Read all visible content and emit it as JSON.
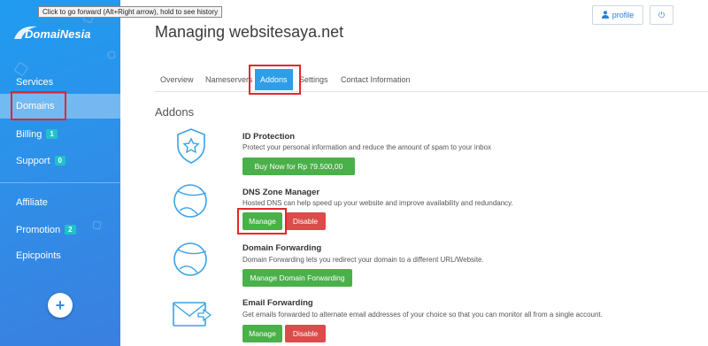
{
  "tooltip": "Click to go forward (Alt+Right arrow), hold to see history",
  "logo": {
    "text": "DomaiNesia"
  },
  "sidebar": {
    "items": [
      {
        "label": "Services",
        "badge": null
      },
      {
        "label": "Domains",
        "badge": null
      },
      {
        "label": "Billing",
        "badge": "1"
      },
      {
        "label": "Support",
        "badge": "0"
      },
      {
        "label": "Affiliate",
        "badge": null
      },
      {
        "label": "Promotion",
        "badge": "2"
      },
      {
        "label": "Epicpoints",
        "badge": null
      }
    ],
    "add_button": "+"
  },
  "header": {
    "title": "Managing websitesaya.net",
    "profile_label": "profile",
    "power_label": "⏻"
  },
  "tabs": [
    "Overview",
    "Nameservers",
    "Addons",
    "Settings",
    "Contact Information"
  ],
  "section_title": "Addons",
  "addons": [
    {
      "title": "ID Protection",
      "description": "Protect your personal information and reduce the amount of spam to your inbox",
      "buttons": [
        "Buy Now for Rp 79.500,00"
      ]
    },
    {
      "title": "DNS Zone Manager",
      "description": "Hosted DNS can help speed up your website and improve availability and redundancy.",
      "buttons": [
        "Manage",
        "Disable"
      ]
    },
    {
      "title": "Domain Forwarding",
      "description": "Domain Forwarding lets you redirect your domain to a different URL/Website.",
      "buttons": [
        "Manage Domain Forwarding"
      ]
    },
    {
      "title": "Email Forwarding",
      "description": "Get emails forwarded to alternate email addresses of your choice so that you can monitor all from a single account.",
      "buttons": [
        "Manage",
        "Disable"
      ]
    }
  ],
  "colors": {
    "sidebar": "#2f8fe8",
    "accent": "#2f9ee8",
    "success": "#4ab049",
    "danger": "#dd4b4b",
    "highlight": "#e5262c"
  }
}
